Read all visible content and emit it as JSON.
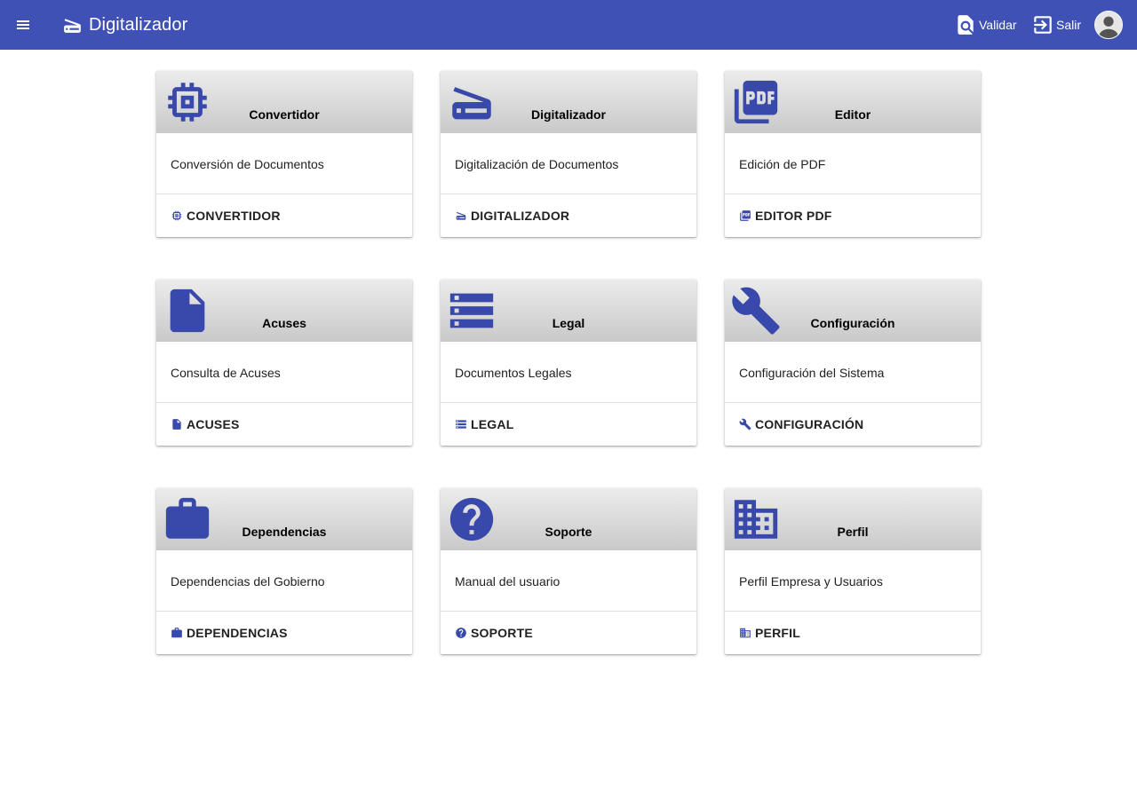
{
  "header": {
    "title": "Digitalizador",
    "actions": [
      {
        "label": "Validar",
        "icon": "find-in-page-icon"
      },
      {
        "label": "Salir",
        "icon": "exit-to-app-icon"
      }
    ],
    "bg_color": "#3f51b5"
  },
  "cards": [
    {
      "title": "Convertidor",
      "description": "Conversión de Documentos",
      "action": "CONVERTIDOR",
      "icon": "memory-chip-icon"
    },
    {
      "title": "Digitalizador",
      "description": "Digitalización de Documentos",
      "action": "DIGITALIZADOR",
      "icon": "scanner-icon"
    },
    {
      "title": "Editor",
      "description": "Edición de PDF",
      "action": "EDITOR PDF",
      "icon": "pdf-icon"
    },
    {
      "title": "Acuses",
      "description": "Consulta de Acuses",
      "action": "ACUSES",
      "icon": "document-icon"
    },
    {
      "title": "Legal",
      "description": "Documentos Legales",
      "action": "LEGAL",
      "icon": "storage-icon"
    },
    {
      "title": "Configuración",
      "description": "Configuración del Sistema",
      "action": "CONFIGURACIÓN",
      "icon": "wrench-icon"
    },
    {
      "title": "Dependencias",
      "description": "Dependencias del Gobierno",
      "action": "DEPENDENCIAS",
      "icon": "briefcase-icon"
    },
    {
      "title": "Soporte",
      "description": "Manual del usuario",
      "action": "SOPORTE",
      "icon": "help-icon"
    },
    {
      "title": "Perfil",
      "description": "Perfil Empresa y Usuarios",
      "action": "PERFIL",
      "icon": "business-icon"
    }
  ],
  "colors": {
    "accent": "#3f51b5",
    "icon": "#3949ab"
  }
}
